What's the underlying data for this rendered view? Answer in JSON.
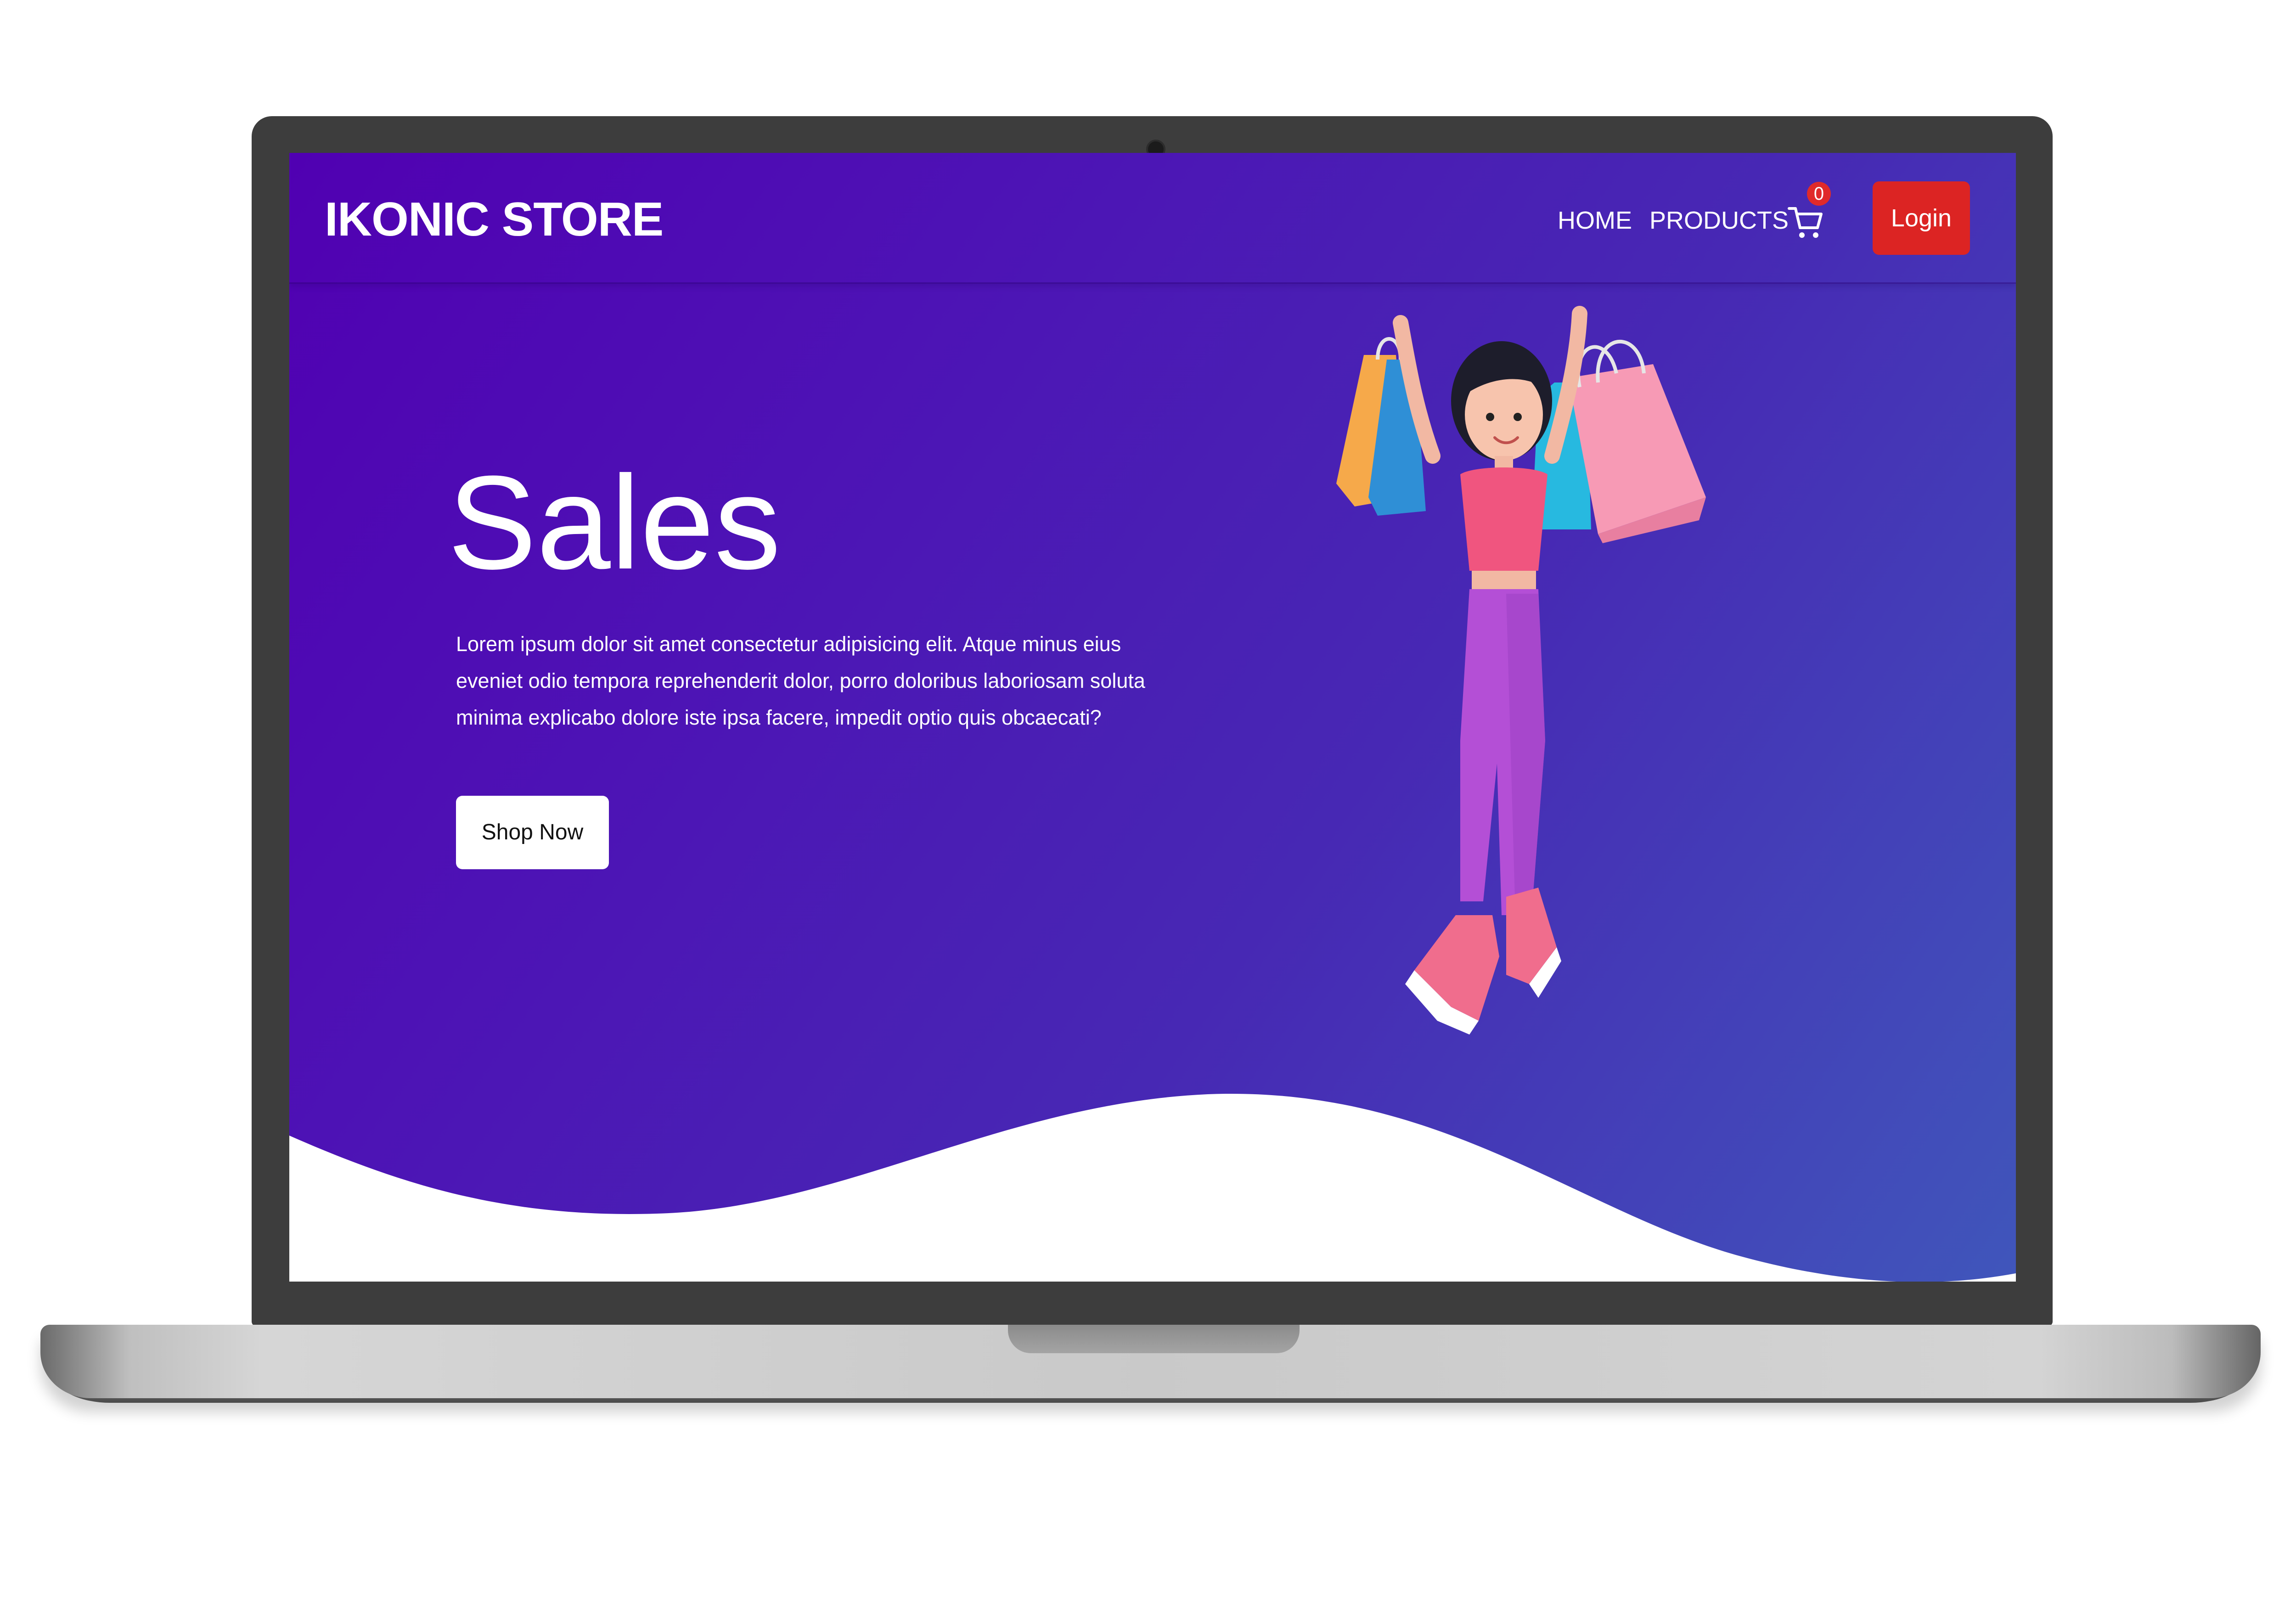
{
  "colors": {
    "bezel": "#3d3d3d",
    "gradient_start": "#5000b2",
    "gradient_end": "#4056bb",
    "login_button": "#dc2423",
    "cart_badge": "#e02a2a",
    "text": "#ffffff"
  },
  "navbar": {
    "brand": "IKONIC STORE",
    "links": [
      {
        "label": "HOME"
      },
      {
        "label": "PRODUCTS"
      }
    ],
    "cart": {
      "icon": "cart-icon",
      "count": "0"
    },
    "login_label": "Login"
  },
  "hero": {
    "title": "Sales",
    "description": "Lorem ipsum dolor sit amet consectetur adipisicing elit. Atque minus eius eveniet odio tempora reprehenderit dolor, porro doloribus laboriosam soluta minima explicabo dolore iste ipsa facere, impedit optio quis obcaecati?",
    "button_label": "Shop Now",
    "illustration": "woman-with-shopping-bags-illustration"
  }
}
